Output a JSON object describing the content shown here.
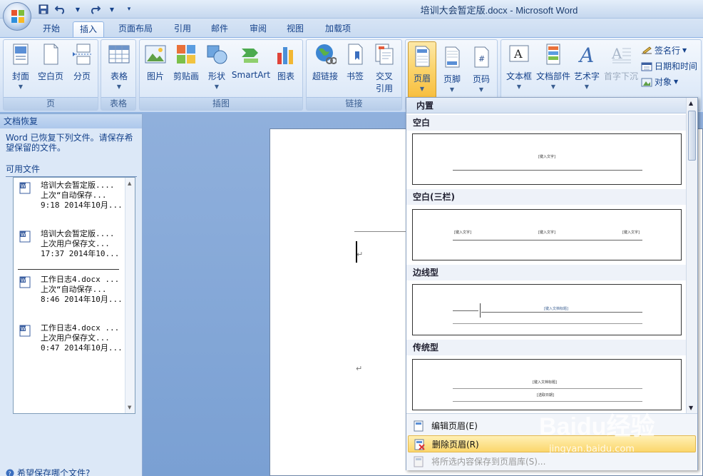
{
  "window": {
    "title": "培训大会暂定版.docx - Microsoft Word"
  },
  "tabs": [
    {
      "label": "开始"
    },
    {
      "label": "插入"
    },
    {
      "label": "页面布局"
    },
    {
      "label": "引用"
    },
    {
      "label": "邮件"
    },
    {
      "label": "审阅"
    },
    {
      "label": "视图"
    },
    {
      "label": "加载项"
    }
  ],
  "ribbon": {
    "groups": {
      "pages": {
        "label": "页",
        "buttons": [
          "封面",
          "空白页",
          "分页"
        ]
      },
      "tables": {
        "label": "表格",
        "buttons": [
          "表格"
        ]
      },
      "illustrations": {
        "label": "插图",
        "buttons": [
          "图片",
          "剪贴画",
          "形状",
          "SmartArt",
          "图表"
        ]
      },
      "links": {
        "label": "链接",
        "buttons": [
          "超链接",
          "书签",
          "交叉",
          "引用"
        ]
      },
      "header_footer": {
        "buttons": [
          "页眉",
          "页脚",
          "页码"
        ]
      },
      "text": {
        "buttons": [
          "文本框",
          "文档部件",
          "艺术字",
          "首字下沉"
        ]
      }
    },
    "small_buttons": {
      "signature": "签名行",
      "datetime": "日期和时间",
      "object": "对象"
    }
  },
  "recovery": {
    "title": "文档恢复",
    "message": "Word 已恢复下列文件。请保存希望保留的文件。",
    "available_label": "可用文件",
    "files": [
      {
        "name": "培训大会暂定版....",
        "status": "上次“自动保存...",
        "time": "9:18 2014年10月..."
      },
      {
        "name": "培训大会暂定版....",
        "status": "上次用户保存文...",
        "time": "17:37 2014年10..."
      },
      {
        "name": "工作日志4.docx ...",
        "status": "上次“自动保存...",
        "time": "8:46 2014年10月..."
      },
      {
        "name": "工作日志4.docx ...",
        "status": "上次用户保存文...",
        "time": "0:47 2014年10月..."
      }
    ],
    "help": "希望保存哪个文件?"
  },
  "gallery": {
    "header": "内置",
    "categories": [
      {
        "label": "空白",
        "placeholders": [
          "[键入文字]"
        ]
      },
      {
        "label": "空白(三栏)",
        "placeholders": [
          "[键入文字]",
          "[键入文字]",
          "[键入文字]"
        ]
      },
      {
        "label": "边线型",
        "placeholders": [
          "[键入文档标题]"
        ]
      },
      {
        "label": "传统型",
        "placeholders": [
          "[键入文档标题]",
          "[选取日期]"
        ]
      }
    ],
    "menu": [
      {
        "label": "编辑页眉(E)"
      },
      {
        "label": "删除页眉(R)"
      },
      {
        "label": "将所选内容保存到页眉库(S)..."
      }
    ]
  },
  "document": {
    "paragraph_mark": "↵"
  },
  "watermark": {
    "brand": "Baidu经验",
    "url": "jingyan.baidu.com"
  }
}
